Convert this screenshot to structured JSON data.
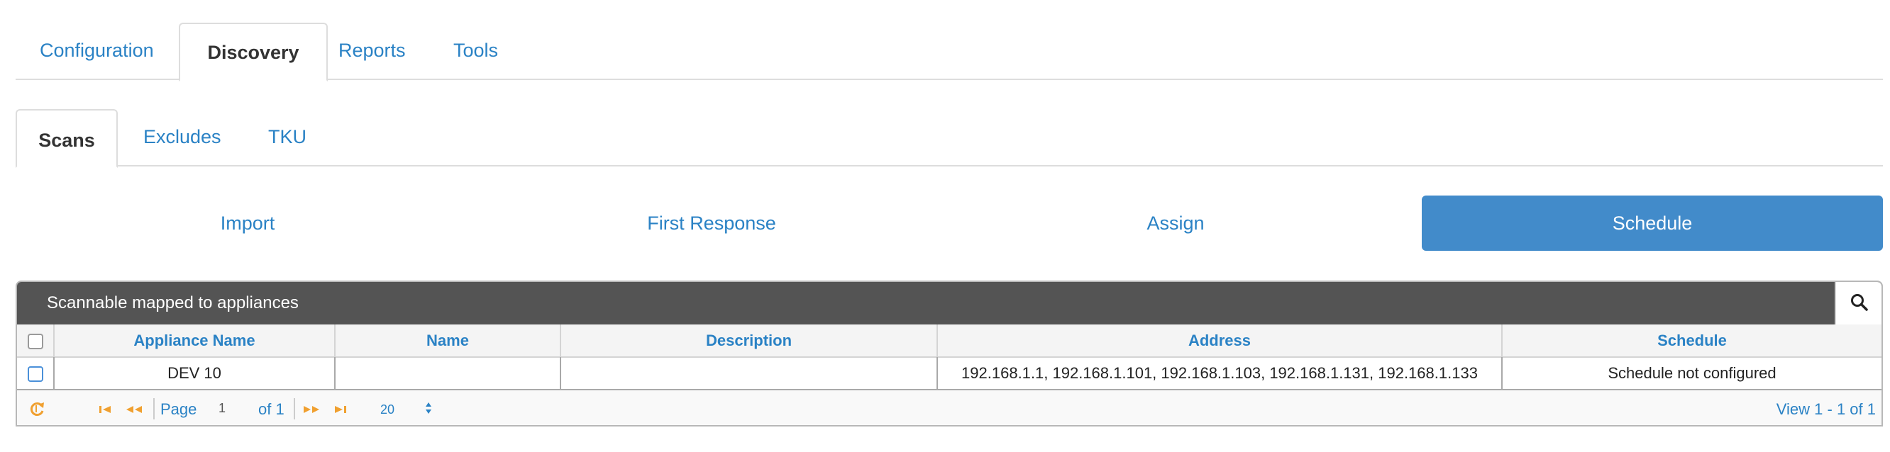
{
  "tabs": [
    {
      "label": "Configuration",
      "active": false
    },
    {
      "label": "Discovery",
      "active": true
    },
    {
      "label": "Reports",
      "active": false
    },
    {
      "label": "Tools",
      "active": false
    }
  ],
  "subtabs": [
    {
      "label": "Scans",
      "active": true
    },
    {
      "label": "Excludes",
      "active": false
    },
    {
      "label": "TKU",
      "active": false
    }
  ],
  "pills": [
    {
      "label": "Import",
      "active": false
    },
    {
      "label": "First Response",
      "active": false
    },
    {
      "label": "Assign",
      "active": false
    },
    {
      "label": "Schedule",
      "active": true
    }
  ],
  "grid": {
    "caption": "Scannable mapped to appliances",
    "columns": [
      "Appliance Name",
      "Name",
      "Description",
      "Address",
      "Schedule"
    ],
    "rows": [
      {
        "appliance_name": "DEV 10",
        "name": "",
        "description": "",
        "address": "192.168.1.1, 192.168.1.101, 192.168.1.103, 192.168.1.131, 192.168.1.133",
        "schedule": "Schedule not configured"
      }
    ],
    "pager": {
      "page_label": "Page",
      "page_value": "1",
      "of_label": "of 1",
      "rows_per_page": "20",
      "view_info": "View 1 - 1 of 1"
    }
  },
  "colors": {
    "link": "#2a82c5",
    "active_pill": "#428bca",
    "caption_bg": "#545454",
    "pager_icon": "#f0a030"
  }
}
